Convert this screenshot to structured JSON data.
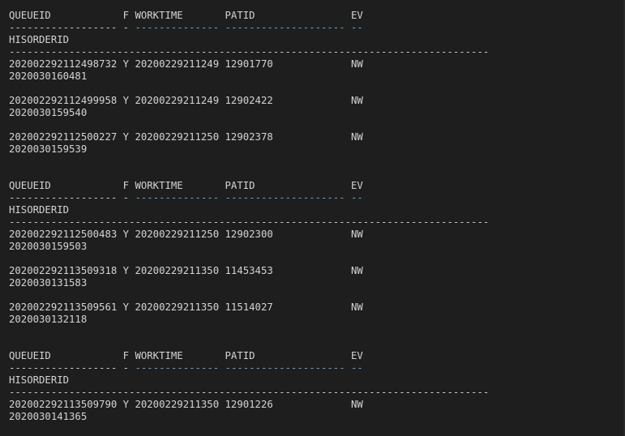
{
  "header": {
    "queueid": "QUEUEID",
    "f": "F",
    "worktime": "WORKTIME",
    "patid": "PATID",
    "ev": "EV",
    "hisorderid": "HISORDERID",
    "sep_queueid": "------------------",
    "sep_f": "-",
    "sep_worktime": "--------------",
    "sep_patid": "--------------------",
    "sep_ev": "--",
    "sep_hisorderid": "--------------------------------------------------------------------------------"
  },
  "blocks": [
    {
      "rows": [
        {
          "queueid": "202002292112498732",
          "f": "Y",
          "worktime": "20200229211249",
          "patid": "12901770",
          "ev": "NW",
          "hisorderid": "2020030160481"
        },
        {
          "queueid": "202002292112499958",
          "f": "Y",
          "worktime": "20200229211249",
          "patid": "12902422",
          "ev": "NW",
          "hisorderid": "2020030159540"
        },
        {
          "queueid": "202002292112500227",
          "f": "Y",
          "worktime": "20200229211250",
          "patid": "12902378",
          "ev": "NW",
          "hisorderid": "2020030159539"
        }
      ]
    },
    {
      "rows": [
        {
          "queueid": "202002292112500483",
          "f": "Y",
          "worktime": "20200229211250",
          "patid": "12902300",
          "ev": "NW",
          "hisorderid": "2020030159503"
        },
        {
          "queueid": "202002292113509318",
          "f": "Y",
          "worktime": "20200229211350",
          "patid": "11453453",
          "ev": "NW",
          "hisorderid": "2020030131583"
        },
        {
          "queueid": "202002292113509561",
          "f": "Y",
          "worktime": "20200229211350",
          "patid": "11514027",
          "ev": "NW",
          "hisorderid": "2020030132118"
        }
      ]
    },
    {
      "rows": [
        {
          "queueid": "202002292113509790",
          "f": "Y",
          "worktime": "20200229211350",
          "patid": "12901226",
          "ev": "NW",
          "hisorderid": "2020030141365"
        }
      ]
    }
  ]
}
